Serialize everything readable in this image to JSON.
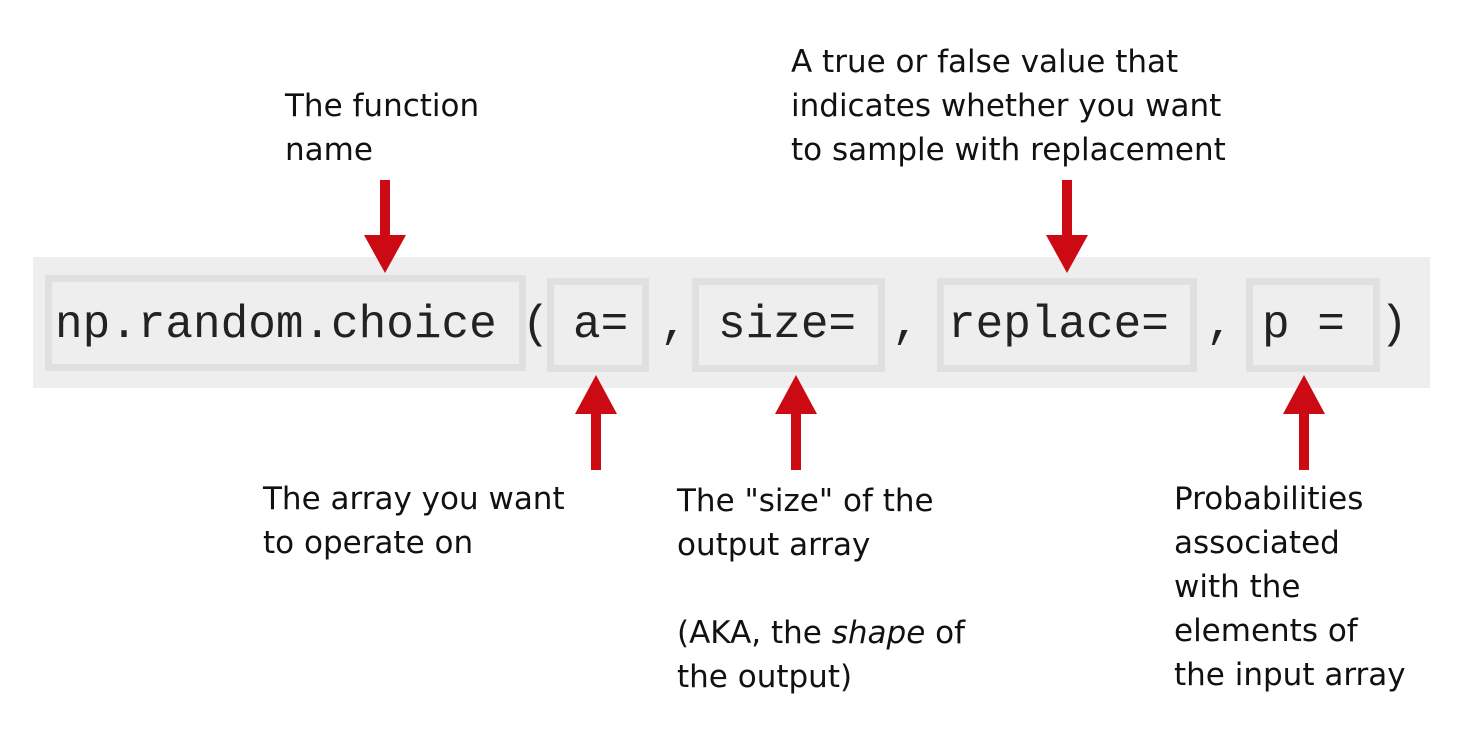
{
  "code": {
    "function": "np.random.choice",
    "open_paren": "(",
    "param_a": "a=",
    "comma": ",",
    "param_size": "size=",
    "param_replace": "replace=",
    "param_p": "p =",
    "close_paren": ")"
  },
  "annotations": {
    "function": [
      "The function",
      "name"
    ],
    "replace": [
      "A true or false value that",
      "indicates whether you want",
      "to sample with replacement"
    ],
    "a": [
      "The array you want",
      "to operate on"
    ],
    "size": [
      "The \"size\" of the",
      "output array"
    ],
    "size_note_prefix": "(AKA, the ",
    "size_note_em": "shape",
    "size_note_suffix": " of",
    "size_note_line2": "the output)",
    "p": [
      "Probabilities",
      "associated",
      "with the",
      "elements of",
      "the input array"
    ]
  },
  "colors": {
    "arrow": "#cc0a14",
    "band": "#eeeeee",
    "box_border": "#e0e0e0"
  }
}
